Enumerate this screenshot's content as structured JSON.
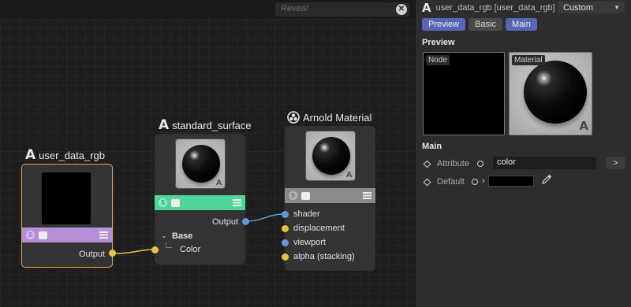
{
  "search": {
    "placeholder": "Reveal",
    "clear_icon": "close-icon"
  },
  "nodes": {
    "user_data_rgb": {
      "title": "user_data_rgb",
      "bar_color": "#b68fd9",
      "output_label": "Output"
    },
    "standard_surface": {
      "title": "standard_surface",
      "bar_color": "#4fd69a",
      "output_label": "Output",
      "group_label": "Base",
      "input_label": "Color"
    },
    "arnold_material": {
      "title": "Arnold Material",
      "bar_color": "#8a8a8a",
      "inputs": [
        "shader",
        "displacement",
        "viewport",
        "alpha (stacking)"
      ]
    }
  },
  "panel": {
    "title": "user_data_rgb [user_data_rgb]",
    "preset": "Custom",
    "tabs": [
      {
        "label": "Preview",
        "active": true
      },
      {
        "label": "Basic",
        "active": false
      },
      {
        "label": "Main",
        "active": true
      }
    ],
    "preview_section": "Preview",
    "preview_node_label": "Node",
    "preview_material_label": "Material",
    "main_section": "Main",
    "attribute_label": "Attribute",
    "attribute_value": "color",
    "attribute_button": ">",
    "default_label": "Default",
    "default_color": "#000000"
  },
  "colors": {
    "accent": "#5865b4",
    "port_yellow": "#e6c33b",
    "port_blue": "#5b9bd8",
    "selected_node_border": "#e8a64a"
  }
}
